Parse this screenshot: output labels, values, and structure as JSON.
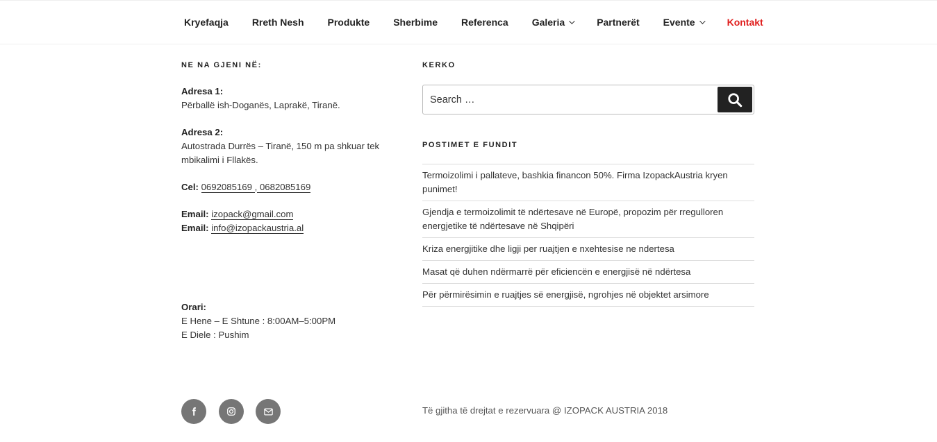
{
  "nav": {
    "items": [
      {
        "label": "Kryefaqja",
        "dropdown": false,
        "active": false
      },
      {
        "label": "Rreth Nesh",
        "dropdown": false,
        "active": false
      },
      {
        "label": "Produkte",
        "dropdown": false,
        "active": false
      },
      {
        "label": "Sherbime",
        "dropdown": false,
        "active": false
      },
      {
        "label": "Referenca",
        "dropdown": false,
        "active": false
      },
      {
        "label": "Galeria",
        "dropdown": true,
        "active": false
      },
      {
        "label": "Partnerët",
        "dropdown": false,
        "active": false
      },
      {
        "label": "Evente",
        "dropdown": true,
        "active": false
      },
      {
        "label": "Kontakt",
        "dropdown": false,
        "active": true
      }
    ],
    "active_color": "#e0201f"
  },
  "contact": {
    "title": "NE NA GJENI NË:",
    "address1_label": "Adresa 1:",
    "address1_text": "Përballë ish-Doganës, Laprakë, Tiranë.",
    "address2_label": "Adresa 2:",
    "address2_line1": "Autostrada Durrës – Tiranë, 150 m pa shkuar tek",
    "address2_line2": "mbikalimi i Fllakës.",
    "phone_label": "Cel:",
    "phone1": "0692085169 ",
    "phone_sep": ",",
    "phone2": " 0682085169",
    "email_label": "Email:",
    "email1": "izopack@gmail.com ",
    "email2": "info@izopackaustria.al",
    "hours_label": "Orari:",
    "hours_line1": "E Hene – E Shtune : 8:00AM–5:00PM",
    "hours_line2": "E Diele : Pushim"
  },
  "search": {
    "title": "KERKO",
    "placeholder": "Search …",
    "icon": "search-icon"
  },
  "recent": {
    "title": "POSTIMET E FUNDIT",
    "posts": [
      "Termoizolimi i pallateve, bashkia financon 50%. Firma IzopackAustria kryen punimet!",
      "Gjendja e termoizolimit të ndërtesave në Europë, propozim për rregulloren energjetike të ndërtesave në Shqipëri",
      "Kriza energjitike dhe ligji per ruajtjen e nxehtesise ne ndertesa",
      "Masat që duhen ndërmarrë për eficiencën e energjisë në ndërtesa",
      "Për përmirësimin e ruajtjes së energjisë, ngrohjes në objektet arsimore"
    ]
  },
  "footer": {
    "social": [
      "facebook-icon",
      "instagram-icon",
      "mail-icon"
    ],
    "copyright": "Të gjitha të drejtat e rezervuara @ IZOPACK AUSTRIA 2018"
  }
}
